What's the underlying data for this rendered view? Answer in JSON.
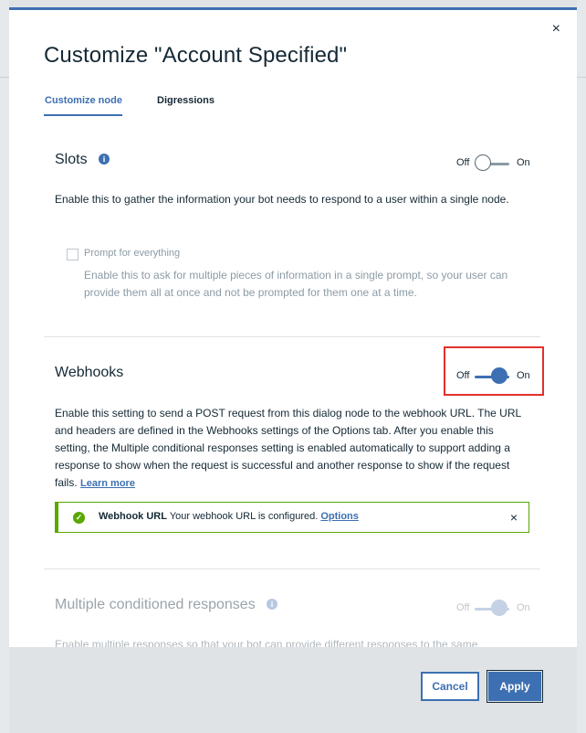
{
  "modal": {
    "title": "Customize \"Account Specified\"",
    "close_glyph": "×",
    "tabs": [
      {
        "label": "Customize node",
        "active": true
      },
      {
        "label": "Digressions",
        "active": false
      }
    ]
  },
  "slots": {
    "title": "Slots",
    "toggle": {
      "off_label": "Off",
      "on_label": "On",
      "state": "off"
    },
    "description": "Enable this to gather the information your bot needs to respond to a user within a single node.",
    "prompt_checkbox_label": "Prompt for everything",
    "prompt_description": "Enable this to ask for multiple pieces of information in a single prompt, so your user can provide them all at once and not be prompted for them one at a time."
  },
  "webhooks": {
    "title": "Webhooks",
    "toggle": {
      "off_label": "Off",
      "on_label": "On",
      "state": "on"
    },
    "description": "Enable this setting to send a POST request from this dialog node to the webhook URL. The URL and headers are defined in the Webhooks settings of the Options tab. After you enable this setting, the Multiple conditional responses setting is enabled automatically to support adding a response to show when the request is successful and another response to show if the request fails.",
    "learn_more": "Learn more",
    "notification": {
      "title": "Webhook URL",
      "message": "Your webhook URL is configured.",
      "link": "Options",
      "close_glyph": "×"
    }
  },
  "multiple_responses": {
    "title": "Multiple conditioned responses",
    "toggle": {
      "off_label": "Off",
      "on_label": "On",
      "state": "on-disabled"
    },
    "description": "Enable multiple responses so that your bot can provide different responses to the same"
  },
  "footer": {
    "cancel_label": "Cancel",
    "apply_label": "Apply"
  },
  "colors": {
    "accent": "#3d70b2",
    "success": "#5aa700",
    "highlight": "#e2312b"
  }
}
